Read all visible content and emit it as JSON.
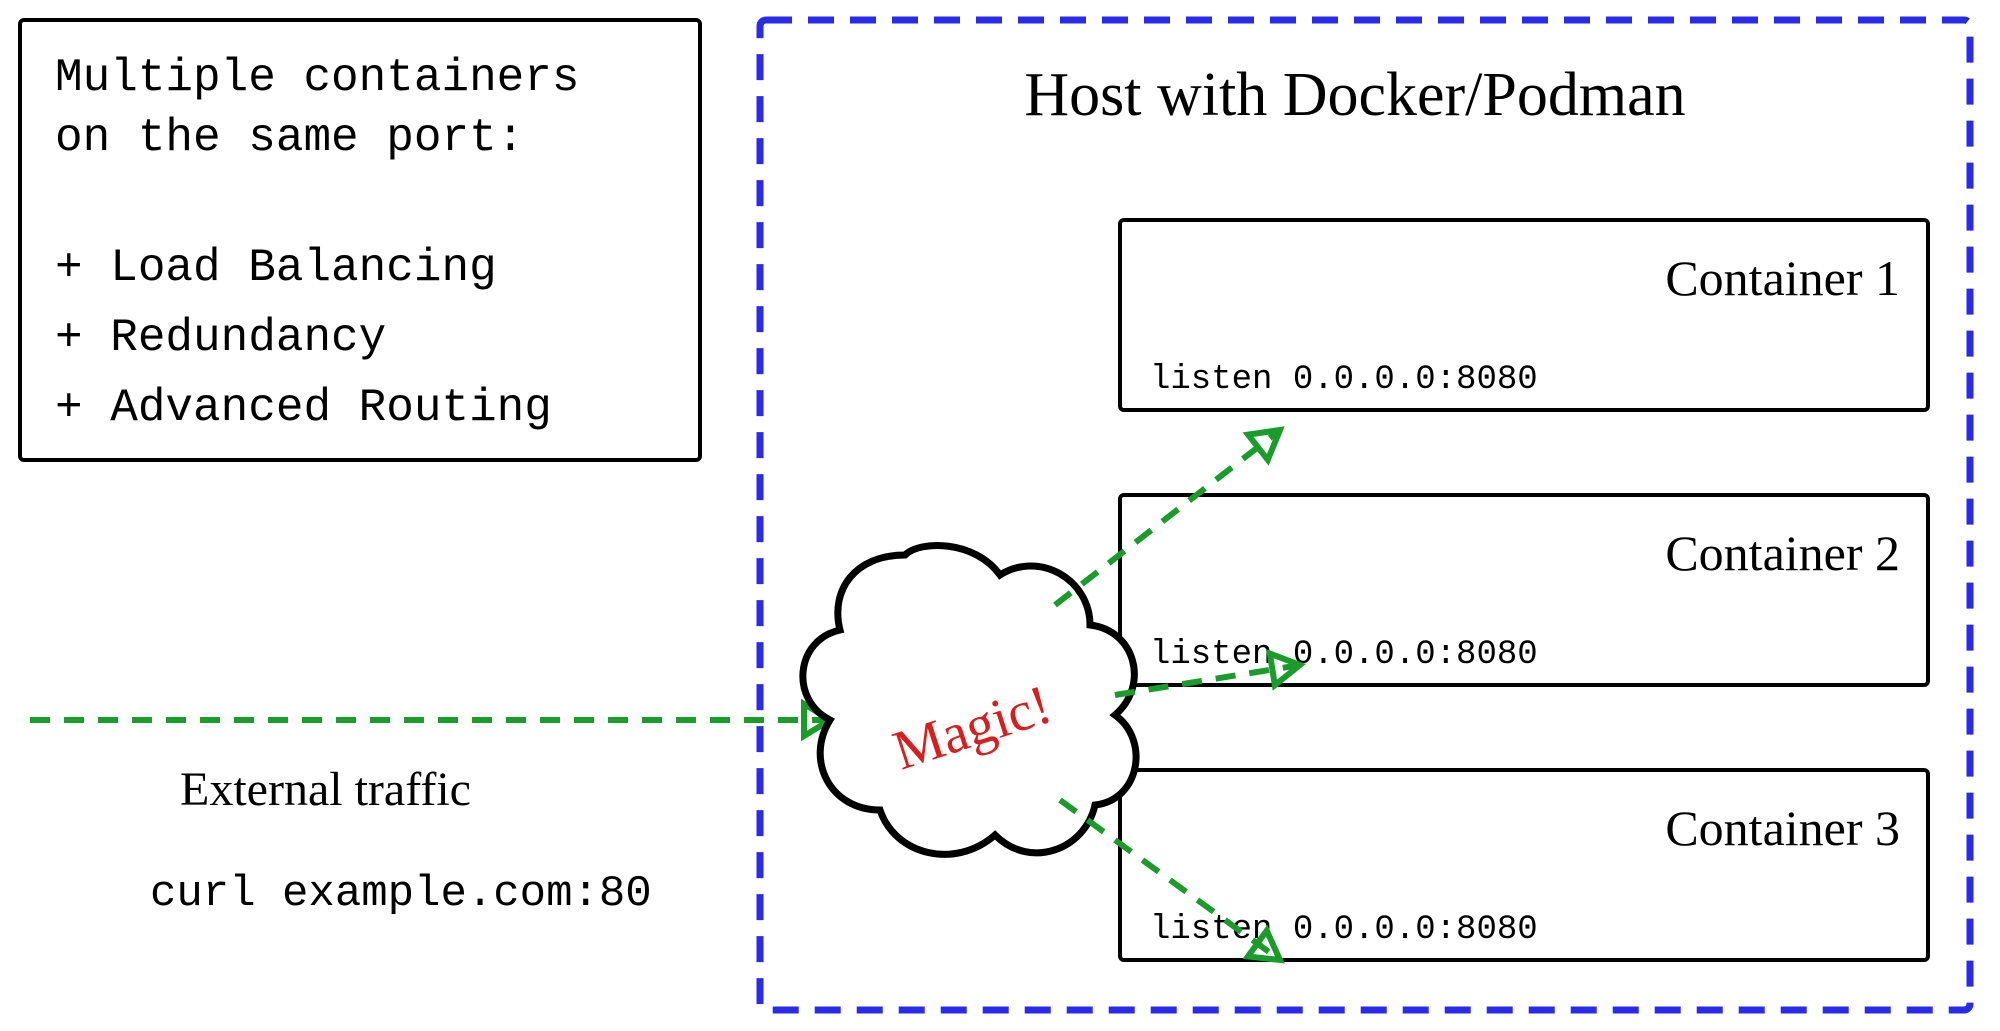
{
  "colors": {
    "host_border": "#2a2be8",
    "arrow": "#1a9c2b",
    "magic_text": "#d81e1e",
    "ink": "#000000"
  },
  "info_box": {
    "title_line1": "Multiple containers",
    "title_line2": "on the same port:",
    "items": [
      "+ Load Balancing",
      "+ Redundancy",
      "+ Advanced Routing"
    ]
  },
  "traffic": {
    "label": "External traffic",
    "command": "curl example.com:80"
  },
  "magic": {
    "label": "Magic!"
  },
  "host": {
    "title": "Host with Docker/Podman"
  },
  "containers": [
    {
      "name": "Container 1",
      "listen": "listen 0.0.0.0:8080"
    },
    {
      "name": "Container 2",
      "listen": "listen 0.0.0.0:8080"
    },
    {
      "name": "Container 3",
      "listen": "listen 0.0.0.0:8080"
    }
  ]
}
